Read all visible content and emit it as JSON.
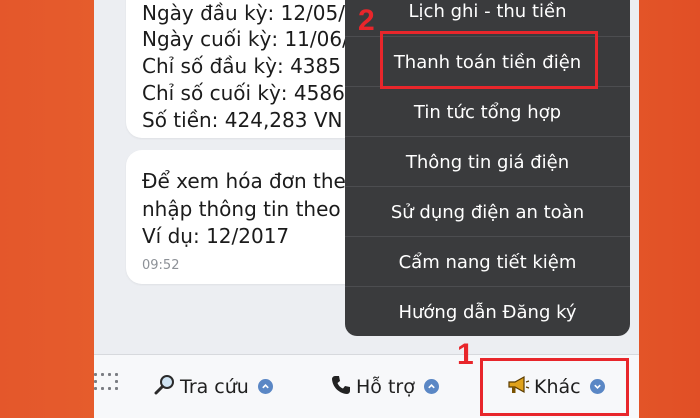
{
  "messages": [
    {
      "lines": [
        "Ngày đầu kỳ: 12/05/",
        "Ngày cuối kỳ: 11/06/",
        "Chỉ số đầu kỳ: 4385",
        "Chỉ số cuối kỳ: 4586",
        "Số tiền: 424,283 VN"
      ]
    },
    {
      "lines": [
        "Để xem hóa đơn the",
        "nhập thông tin theo",
        "Ví dụ: 12/2017"
      ],
      "time": "09:52"
    }
  ],
  "menu": {
    "items": [
      "Lịch ghi - thu tiền",
      "Thanh toán tiền điện",
      "Tin tức tổng hợp",
      "Thông tin giá điện",
      "Sử dụng điện an toàn",
      "Cẩm nang tiết kiệm",
      "Hướng dẫn Đăng ký"
    ]
  },
  "tabbar": {
    "tabs": [
      {
        "label": "Tra cứu",
        "icon": "magnifier-icon"
      },
      {
        "label": "Hỗ trợ",
        "icon": "telephone-icon"
      },
      {
        "label": "Khác",
        "icon": "megaphone-icon"
      }
    ]
  },
  "annotations": {
    "step1": "1",
    "step2": "2",
    "highlight_color": "#e8262b"
  }
}
